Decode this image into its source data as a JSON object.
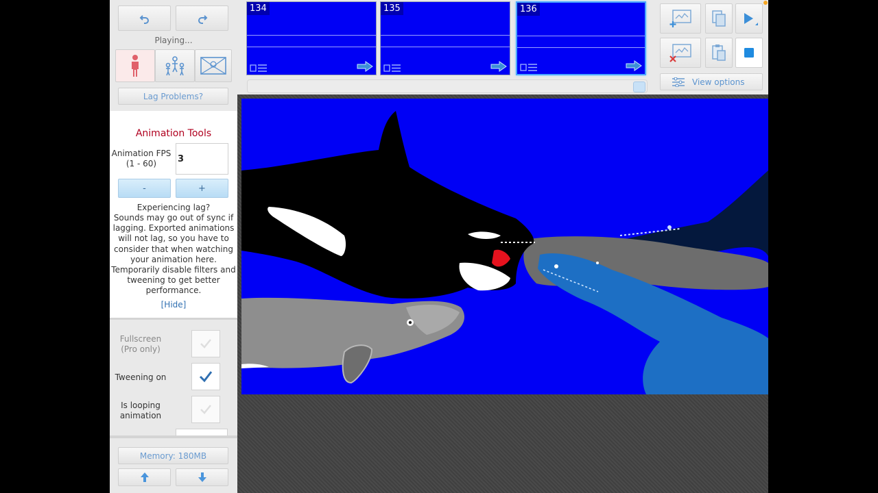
{
  "playback": {
    "status": "Playing...",
    "lag_button": "Lag Problems?"
  },
  "animation_tools": {
    "title": "Animation Tools",
    "fps_label_line1": "Animation FPS",
    "fps_label_line2": "(1 - 60)",
    "fps_value": "3",
    "minus_label": "-",
    "plus_label": "+",
    "lag_info_line1": "Experiencing lag?",
    "lag_info_line2": "Sounds may go out of sync if",
    "lag_info_line3": "lagging. Exported animations",
    "lag_info_line4": "will not lag, so you have to",
    "lag_info_line5": "consider that when watching",
    "lag_info_line6": "your animation here.",
    "lag_info_line7": "Temporarily disable filters and",
    "lag_info_line8": "tweening to get better",
    "lag_info_line9": "performance.",
    "hide_link": "[Hide]"
  },
  "options": {
    "fullscreen_line1": "Fullscreen",
    "fullscreen_line2": "(Pro only)",
    "tweening_label": "Tweening on",
    "looping_line1": "Is looping",
    "looping_line2": "animation"
  },
  "footer": {
    "memory": "Memory: 180MB"
  },
  "timeline": {
    "frames": [
      {
        "number": "134"
      },
      {
        "number": "135"
      },
      {
        "number": "136"
      }
    ]
  },
  "tools": {
    "view_options": "View options"
  },
  "colors": {
    "stage_bg": "#0000f5",
    "accent_red": "#b0001f",
    "accent_blue": "#3c8fd8"
  }
}
